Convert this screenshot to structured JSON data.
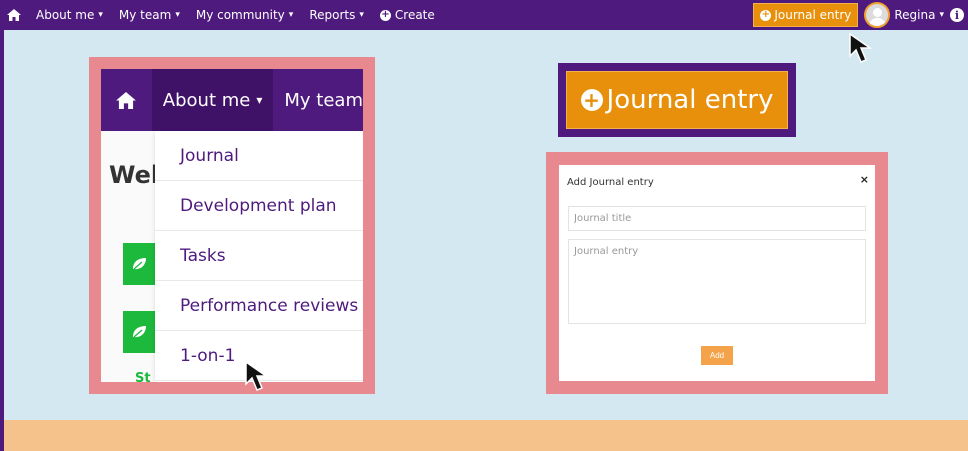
{
  "topnav": {
    "items": [
      {
        "label": "About me",
        "chevron": "▾"
      },
      {
        "label": "My team",
        "chevron": "▾"
      },
      {
        "label": "My community",
        "chevron": "▾"
      },
      {
        "label": "Reports",
        "chevron": "▾"
      }
    ],
    "create_label": "Create",
    "journal_button": "Journal entry",
    "user_name": "Regina",
    "user_chevron": "▾",
    "info_glyph": "i"
  },
  "zoom_menu": {
    "about_label": "About me",
    "myteam_label": "My team",
    "welcome_partial": "Wel",
    "status_partial": "St",
    "dropdown": [
      {
        "label": "Journal"
      },
      {
        "label": "Development plan"
      },
      {
        "label": "Tasks"
      },
      {
        "label": "Performance reviews"
      },
      {
        "label": "1-on-1"
      }
    ]
  },
  "zoom_button": {
    "label": "Journal entry"
  },
  "modal": {
    "title": "Add Journal entry",
    "close_glyph": "×",
    "title_placeholder": "Journal title",
    "entry_placeholder": "Journal entry",
    "add_label": "Add"
  },
  "colors": {
    "nav_purple": "#4e1a7d",
    "accent_orange": "#e8900c",
    "highlight_pink": "#e8898f",
    "background_blue": "#d3e8f0",
    "bottom_band": "#f4c28a",
    "leaf_green": "#1cb93c"
  },
  "icons": [
    "home-icon",
    "plus-circle-icon",
    "chevron-down-icon",
    "avatar",
    "info-icon",
    "leaf-icon",
    "close-icon",
    "mouse-cursor-icon"
  ]
}
